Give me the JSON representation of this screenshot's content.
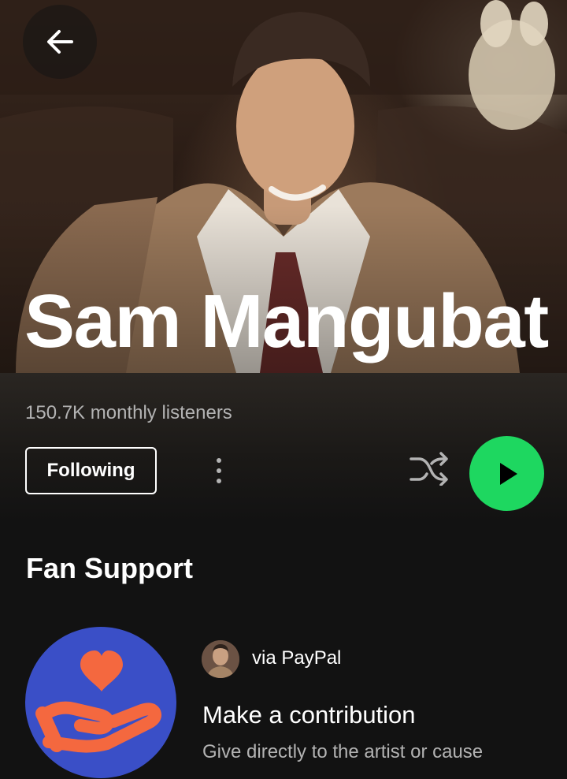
{
  "header": {
    "back_icon": "arrow-left-icon",
    "cover_image": "artist-photo"
  },
  "artist": {
    "name": "Sam Mangubat",
    "monthly_listeners": "150.7K monthly listeners"
  },
  "actions": {
    "follow_label": "Following",
    "more_icon": "more-vertical-icon",
    "shuffle_icon": "shuffle-icon",
    "play_icon": "play-icon",
    "play_color": "#1ed760"
  },
  "fan_support": {
    "title": "Fan Support",
    "card": {
      "art_icon": "heart-in-hand-icon",
      "art_bg": "#3a4fc7",
      "art_accent": "#f4683f",
      "via_label": "via PayPal",
      "title": "Make a contribution",
      "subtitle": "Give directly to the artist or cause"
    }
  }
}
